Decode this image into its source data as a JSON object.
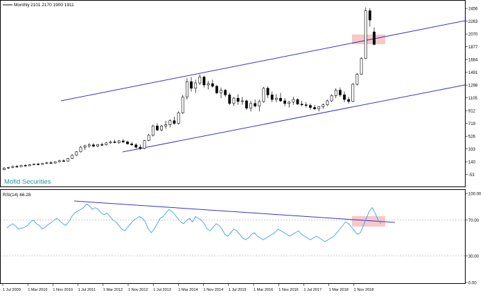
{
  "header": {
    "symbol": "‎‏⁠",
    "symbol_text": "═══",
    "timeframe": "Monthly",
    "ohlc": "2101 2170 1900 1911"
  },
  "watermark": "Mofid Securities",
  "price_axis": {
    "labels": [
      "2456",
      "2263",
      "2070",
      "1877",
      "1684",
      "1491",
      "1298",
      "1105",
      "912",
      "719",
      "526",
      "333",
      "140",
      "-53"
    ]
  },
  "rsi_panel": {
    "label": "RSI(14) 66.28",
    "axis_labels": [
      "100.00",
      "70.00",
      "30.00",
      "0.00"
    ],
    "levels": [
      70,
      30
    ]
  },
  "time_axis": {
    "labels": [
      "1 Jul 2009",
      "1 Mar 2010",
      "1 Nov 2010",
      "1 Jul 2011",
      "1 Mar 2012",
      "1 Nov 2012",
      "1 Jul 2013",
      "1 Mar 2014",
      "1 Nov 2014",
      "1 Jul 2015",
      "1 Mar 2016",
      "1 Nov 2016",
      "1 Jul 2017",
      "1 Mar 2018",
      "1 Nov 2018"
    ]
  },
  "colors": {
    "channel_line": "#3333cc",
    "rsi_line": "#3d9df3",
    "highlight": "#f4b6b6",
    "watermark": "#1a9a9a",
    "candle_bull": "#ffffff",
    "candle_bear": "#000000"
  },
  "chart_data": {
    "type": "candlestick",
    "series_note": "",
    "price": {
      "ylim": [
        -150,
        2520
      ],
      "candles": [
        [
          20,
          60,
          10,
          45
        ],
        [
          45,
          65,
          30,
          55
        ],
        [
          55,
          80,
          40,
          70
        ],
        [
          70,
          90,
          55,
          65
        ],
        [
          65,
          95,
          60,
          85
        ],
        [
          85,
          100,
          70,
          80
        ],
        [
          80,
          105,
          75,
          95
        ],
        [
          95,
          115,
          85,
          105
        ],
        [
          105,
          125,
          95,
          100
        ],
        [
          100,
          120,
          90,
          115
        ],
        [
          115,
          135,
          105,
          125
        ],
        [
          125,
          145,
          115,
          120
        ],
        [
          120,
          150,
          110,
          140
        ],
        [
          140,
          170,
          130,
          155
        ],
        [
          155,
          175,
          140,
          150
        ],
        [
          150,
          200,
          145,
          190
        ],
        [
          190,
          250,
          180,
          240
        ],
        [
          240,
          300,
          230,
          290
        ],
        [
          290,
          380,
          280,
          360
        ],
        [
          360,
          400,
          320,
          380
        ],
        [
          380,
          420,
          350,
          395
        ],
        [
          395,
          420,
          360,
          375
        ],
        [
          375,
          410,
          360,
          400
        ],
        [
          400,
          430,
          380,
          395
        ],
        [
          395,
          440,
          385,
          425
        ],
        [
          425,
          460,
          410,
          440
        ],
        [
          440,
          470,
          420,
          430
        ],
        [
          430,
          470,
          410,
          455
        ],
        [
          455,
          480,
          420,
          440
        ],
        [
          440,
          460,
          400,
          410
        ],
        [
          410,
          440,
          380,
          395
        ],
        [
          395,
          420,
          340,
          360
        ],
        [
          360,
          400,
          320,
          340
        ],
        [
          340,
          470,
          330,
          460
        ],
        [
          460,
          560,
          450,
          540
        ],
        [
          540,
          700,
          520,
          680
        ],
        [
          680,
          720,
          600,
          620
        ],
        [
          620,
          700,
          600,
          680
        ],
        [
          680,
          760,
          640,
          700
        ],
        [
          700,
          780,
          660,
          760
        ],
        [
          760,
          820,
          700,
          720
        ],
        [
          720,
          900,
          700,
          880
        ],
        [
          880,
          1150,
          860,
          1120
        ],
        [
          1120,
          1400,
          1080,
          1350
        ],
        [
          1350,
          1420,
          1200,
          1250
        ],
        [
          1250,
          1380,
          1180,
          1330
        ],
        [
          1330,
          1460,
          1300,
          1420
        ],
        [
          1420,
          1440,
          1260,
          1300
        ],
        [
          1300,
          1360,
          1230,
          1320
        ],
        [
          1320,
          1380,
          1260,
          1280
        ],
        [
          1280,
          1300,
          1160,
          1180
        ],
        [
          1180,
          1260,
          1100,
          1220
        ],
        [
          1220,
          1240,
          1120,
          1150
        ],
        [
          1150,
          1180,
          1000,
          1020
        ],
        [
          1020,
          1120,
          980,
          1100
        ],
        [
          1100,
          1160,
          1000,
          1050
        ],
        [
          1050,
          1120,
          1000,
          1060
        ],
        [
          1060,
          1080,
          920,
          950
        ],
        [
          950,
          1060,
          900,
          1020
        ],
        [
          1020,
          1080,
          960,
          980
        ],
        [
          980,
          1080,
          900,
          1050
        ],
        [
          1050,
          1270,
          1030,
          1250
        ],
        [
          1250,
          1280,
          1100,
          1150
        ],
        [
          1150,
          1200,
          1040,
          1080
        ],
        [
          1080,
          1160,
          1040,
          1100
        ],
        [
          1100,
          1180,
          1040,
          1060
        ],
        [
          1060,
          1100,
          980,
          1020
        ],
        [
          1020,
          1060,
          960,
          1040
        ],
        [
          1040,
          1120,
          1000,
          1080
        ],
        [
          1080,
          1100,
          1000,
          1010
        ],
        [
          1010,
          1060,
          980,
          1000
        ],
        [
          1000,
          1040,
          960,
          990
        ],
        [
          990,
          1020,
          930,
          960
        ],
        [
          960,
          1000,
          920,
          940
        ],
        [
          940,
          980,
          900,
          970
        ],
        [
          970,
          1020,
          940,
          1000
        ],
        [
          1000,
          1080,
          980,
          1060
        ],
        [
          1060,
          1160,
          1040,
          1140
        ],
        [
          1140,
          1250,
          1100,
          1220
        ],
        [
          1220,
          1260,
          1120,
          1150
        ],
        [
          1150,
          1200,
          1040,
          1080
        ],
        [
          1080,
          1120,
          1020,
          1050
        ],
        [
          1050,
          1330,
          1040,
          1310
        ],
        [
          1310,
          1480,
          1290,
          1460
        ],
        [
          1460,
          1720,
          1450,
          1700
        ],
        [
          1700,
          2470,
          1690,
          2420
        ],
        [
          2420,
          2460,
          2180,
          2280
        ],
        [
          2101,
          2170,
          1900,
          1911
        ]
      ]
    },
    "rsi": {
      "ylim": [
        0,
        100
      ],
      "values": [
        61,
        64,
        66,
        63,
        60,
        61,
        62,
        64,
        68,
        70,
        66,
        64,
        60,
        62,
        65,
        67,
        70,
        72,
        69,
        66,
        64,
        68,
        74,
        78,
        80,
        82,
        84,
        88,
        86,
        82,
        84,
        82,
        78,
        76,
        78,
        74,
        70,
        68,
        64,
        60,
        58,
        62,
        66,
        70,
        72,
        74,
        72,
        68,
        60,
        56,
        60,
        66,
        72,
        74,
        78,
        82,
        80,
        76,
        72,
        68,
        66,
        70,
        72,
        68,
        74,
        72,
        70,
        66,
        60,
        58,
        62,
        66,
        64,
        60,
        54,
        52,
        56,
        60,
        58,
        54,
        50,
        48,
        50,
        54,
        56,
        52,
        50,
        48,
        50,
        52,
        54,
        56,
        60,
        58,
        56,
        54,
        52,
        54,
        56,
        58,
        54,
        52,
        50,
        48,
        50,
        52,
        50,
        48,
        46,
        48,
        50,
        52,
        56,
        60,
        64,
        68,
        66,
        62,
        58,
        54,
        56,
        64,
        72,
        80,
        84,
        78,
        70,
        66
      ]
    }
  }
}
